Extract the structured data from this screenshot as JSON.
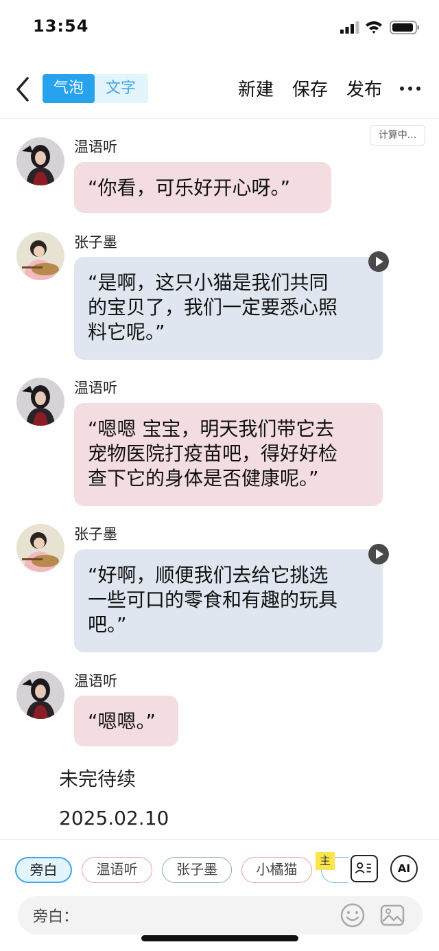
{
  "status_bar": {
    "time": "13:54"
  },
  "nav": {
    "mode_bubble": "气泡",
    "mode_text": "文字",
    "new_label": "新建",
    "save_label": "保存",
    "publish_label": "发布"
  },
  "calc_badge": "计算中...",
  "messages": [
    {
      "speaker": "温语听",
      "text": "“你看，可乐好开心呀。”",
      "style": "pink",
      "has_audio": false
    },
    {
      "speaker": "张子墨",
      "lines": [
        "“是啊，这只小猫是我们共同",
        "的宝贝了，我们一定要悉心照",
        "料它呢。”"
      ],
      "style": "blue",
      "has_audio": true
    },
    {
      "speaker": "温语听",
      "lines": [
        "“嗯嗯 宝宝，明天我们带它去",
        "宠物医院打疫苗吧，得好好检",
        "查下它的身体是否健康呢。”"
      ],
      "style": "pink",
      "has_audio": false
    },
    {
      "speaker": "张子墨",
      "lines": [
        "“好啊，顺便我们去给它挑选",
        "一些可口的零食和有趣的玩具",
        "吧。”"
      ],
      "style": "blue",
      "has_audio": true
    },
    {
      "speaker": "温语听",
      "text": "“嗯嗯。”",
      "style": "pink",
      "has_audio": false
    }
  ],
  "narration": {
    "tbc": "未完待续",
    "date": "2025.02.10"
  },
  "roles": {
    "narrator": "旁白",
    "wen": "温语听",
    "zhang": "张子墨",
    "cat": "小橘猫",
    "main_badge": "主",
    "ai_label": "AI"
  },
  "input": {
    "label": "旁白："
  },
  "colors": {
    "accent": "#27a3ee",
    "pink_bubble": "#f4dde0",
    "blue_bubble": "#e0e6ef"
  }
}
